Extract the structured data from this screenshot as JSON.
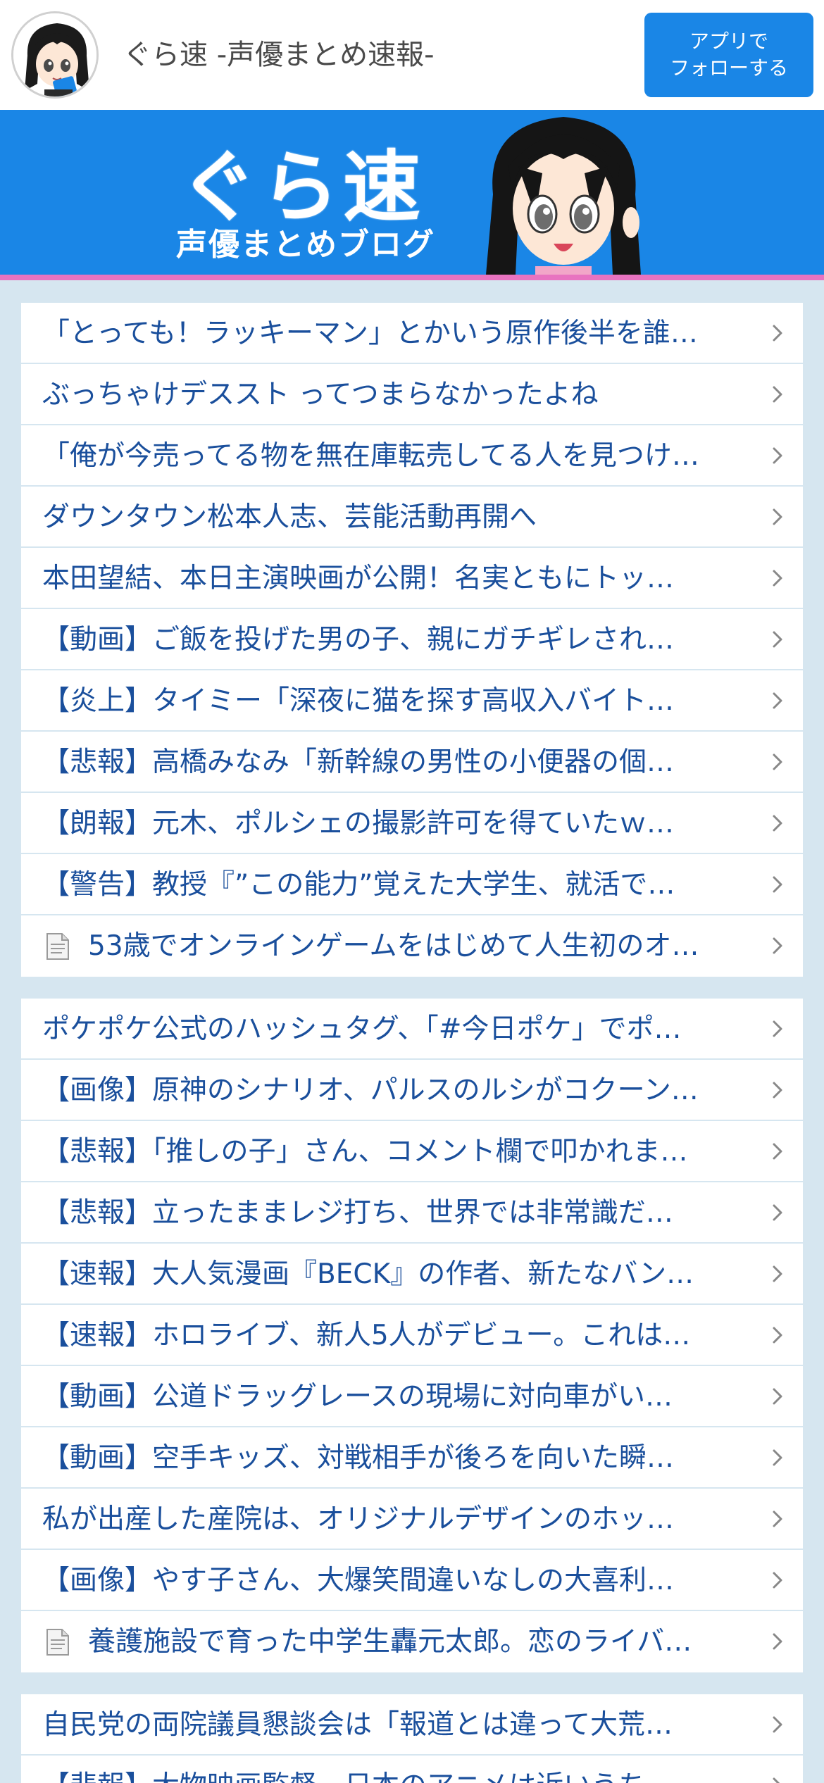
{
  "header": {
    "site_title": "ぐら速  -声優まとめ速報-",
    "follow_button_line1": "アプリで",
    "follow_button_line2": "フォローする"
  },
  "banner": {
    "logo_main": "ぐら速",
    "logo_sub": "声優まとめブログ"
  },
  "colors": {
    "accent_blue": "#1a86e6",
    "link_text": "#1a4f9c",
    "page_bg": "#d6e6f0",
    "banner_stripe": "#e873c0"
  },
  "blocks": [
    {
      "items": [
        {
          "text": "「とっても！ラッキーマン」とかいう原作後半を誰…",
          "icon": ""
        },
        {
          "text": "ぶっちゃけデススト ってつまらなかったよね",
          "icon": ""
        },
        {
          "text": "「俺が今売ってる物を無在庫転売してる人を見つけ…",
          "icon": ""
        },
        {
          "text": "ダウンタウン松本人志、芸能活動再開へ",
          "icon": ""
        },
        {
          "text": "本田望結、本日主演映画が公開！名実ともにトッ…",
          "icon": ""
        },
        {
          "text": "【動画】ご飯を投げた男の子、親にガチギレされ…",
          "icon": ""
        },
        {
          "text": "【炎上】タイミー「深夜に猫を探す高収入バイト…",
          "icon": ""
        },
        {
          "text": "【悲報】高橋みなみ「新幹線の男性の小便器の個…",
          "icon": ""
        },
        {
          "text": "【朗報】元木、ポルシェの撮影許可を得ていたｗ…",
          "icon": ""
        },
        {
          "text": "【警告】教授『”この能力”覚えた大学生、就活で…",
          "icon": ""
        },
        {
          "text": "53歳でオンラインゲームをはじめて人生初のオ…",
          "icon": "document-icon"
        }
      ]
    },
    {
      "items": [
        {
          "text": "ポケポケ公式のハッシュタグ、「#今日ポケ」でポ…",
          "icon": ""
        },
        {
          "text": "【画像】原神のシナリオ、パルスのルシがコクーン…",
          "icon": ""
        },
        {
          "text": "【悲報】「推しの子」さん、コメント欄で叩かれま…",
          "icon": ""
        },
        {
          "text": "【悲報】立ったままレジ打ち、世界では非常識だ…",
          "icon": ""
        },
        {
          "text": "【速報】大人気漫画『BECK』の作者、新たなバン…",
          "icon": ""
        },
        {
          "text": "【速報】ホロライブ、新人5人がデビュー。これは…",
          "icon": ""
        },
        {
          "text": "【動画】公道ドラッグレースの現場に対向車がい…",
          "icon": ""
        },
        {
          "text": "【動画】空手キッズ、対戦相手が後ろを向いた瞬…",
          "icon": ""
        },
        {
          "text": "私が出産した産院は、オリジナルデザインのホッ…",
          "icon": ""
        },
        {
          "text": "【画像】やす子さん、大爆笑間違いなしの大喜利…",
          "icon": ""
        },
        {
          "text": "養護施設で育った中学生轟元太郎。恋のライバ…",
          "icon": "document-icon"
        }
      ]
    },
    {
      "items": [
        {
          "text": "自民党の両院議員懇談会は「報道とは違って大荒…",
          "icon": ""
        },
        {
          "text": "【悲報】大物映画監督、日本のアニメは近いうち…",
          "icon": ""
        }
      ]
    }
  ]
}
